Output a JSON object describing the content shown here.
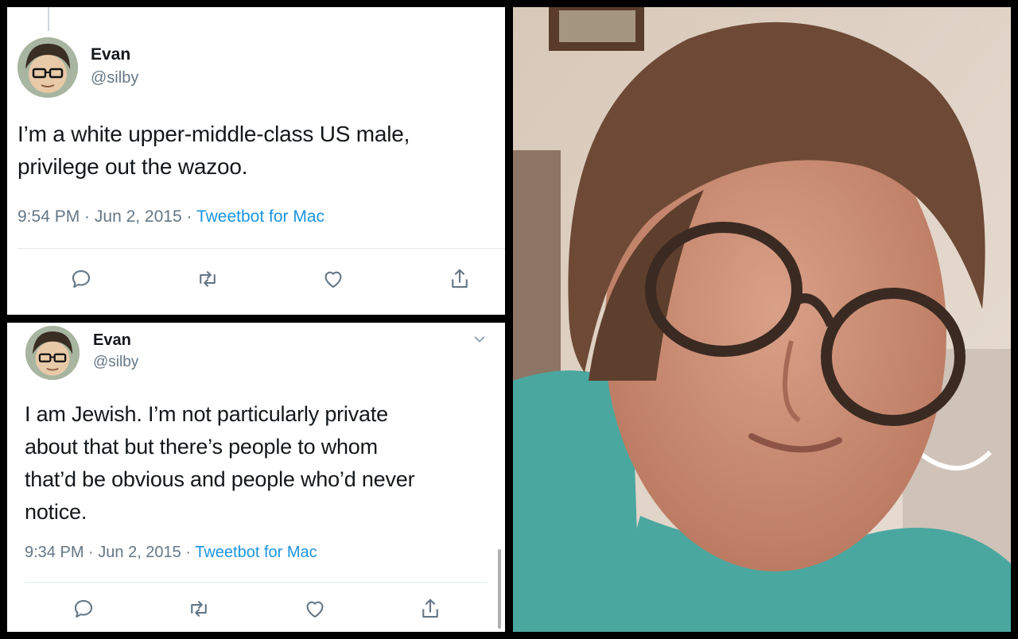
{
  "tweets": [
    {
      "name": "Evan",
      "handle": "@silby",
      "text_lines": [
        "I’m a white upper-middle-class US male,",
        "privilege out the wazoo."
      ],
      "time": "9:54 PM",
      "sep1": " · ",
      "date": "Jun 2, 2015",
      "sep2": " · ",
      "source": "Tweetbot for Mac"
    },
    {
      "name": "Evan",
      "handle": "@silby",
      "text_lines": [
        "I am Jewish. I’m not particularly private",
        "about that but there’s people to whom",
        "that’d be obvious and people who’d never",
        "notice."
      ],
      "time": "9:34 PM",
      "sep1": " · ",
      "date": "Jun 2, 2015",
      "sep2": " · ",
      "source": "Tweetbot for Mac"
    }
  ],
  "icons": {
    "reply": "reply-icon",
    "retweet": "retweet-icon",
    "like": "heart-icon",
    "share": "share-icon",
    "more": "chevron-down-icon"
  },
  "colors": {
    "link": "#1b95e0",
    "secondary_text": "#657786",
    "primary_text": "#14171a",
    "shirt": "#4aa79f"
  }
}
